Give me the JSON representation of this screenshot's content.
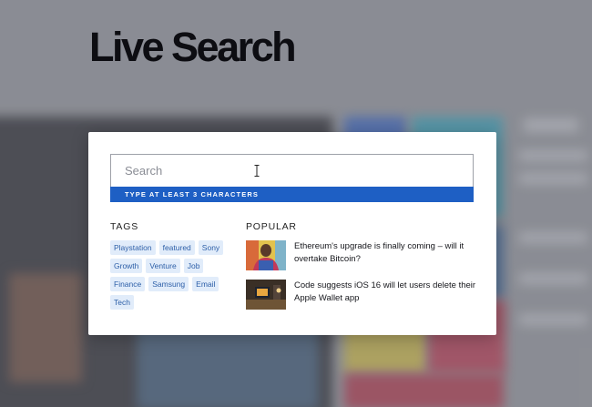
{
  "page": {
    "title": "Live Search"
  },
  "search": {
    "placeholder": "Search",
    "hint": "TYPE AT LEAST 3 CHARACTERS"
  },
  "tags": {
    "heading": "TAGS",
    "items": [
      "Playstation",
      "featured",
      "Sony",
      "Growth",
      "Venture",
      "Job",
      "Finance",
      "Samsung",
      "Email",
      "Tech"
    ]
  },
  "popular": {
    "heading": "POPULAR",
    "items": [
      {
        "title": "Ethereum's upgrade is finally coming – will it overtake Bitcoin?",
        "thumbnail": "man-portrait-thumbnail"
      },
      {
        "title": "Code suggests iOS 16 will let users delete their Apple Wallet app",
        "thumbnail": "room-screen-thumbnail"
      }
    ]
  },
  "colors": {
    "accent": "#1e5fc4",
    "tag_bg": "#e1ecfa",
    "tag_text": "#2d5fa8",
    "title": "#0d0d12"
  }
}
